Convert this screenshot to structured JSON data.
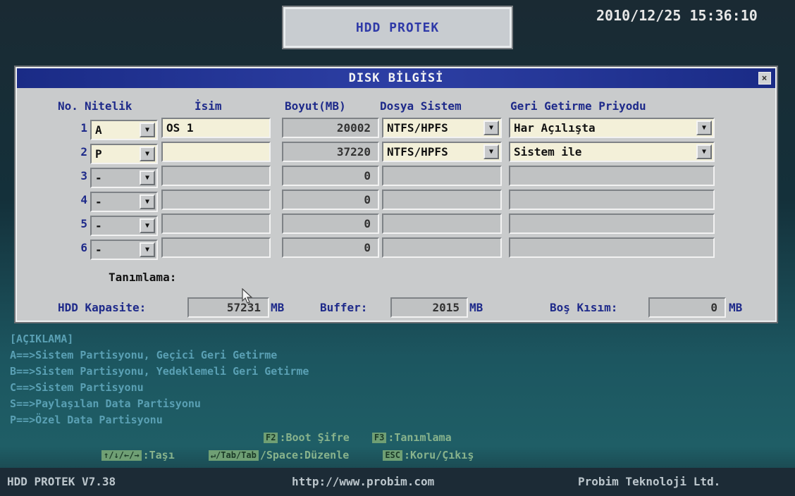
{
  "window": {
    "title": "HDD PROTEK",
    "clock": "2010/12/25 15:36:10"
  },
  "dialog": {
    "title": "DISK BİLGİSİ",
    "close_glyph": "×",
    "headers": {
      "no": "No.",
      "attribute": "Nitelik",
      "name": "İsim",
      "size": "Boyut(MB)",
      "filesystem": "Dosya Sistem",
      "restore": "Geri Getirme Priyodu"
    },
    "partitions": [
      {
        "no": "1",
        "attr": "A",
        "name": "OS 1",
        "size": "20002",
        "fs": "NTFS/HPFS",
        "restore": "Har Açılışta"
      },
      {
        "no": "2",
        "attr": "P",
        "name": "",
        "size": "37220",
        "fs": "NTFS/HPFS",
        "restore": "Sistem ile"
      },
      {
        "no": "3",
        "attr": "-",
        "name": "",
        "size": "0",
        "fs": "",
        "restore": ""
      },
      {
        "no": "4",
        "attr": "-",
        "name": "",
        "size": "0",
        "fs": "",
        "restore": ""
      },
      {
        "no": "5",
        "attr": "-",
        "name": "",
        "size": "0",
        "fs": "",
        "restore": ""
      },
      {
        "no": "6",
        "attr": "-",
        "name": "",
        "size": "0",
        "fs": "",
        "restore": ""
      }
    ],
    "description_label": "Tanımlama:",
    "capacity": {
      "label": "HDD Kapasite:",
      "value": "57231",
      "unit": "MB"
    },
    "buffer": {
      "label": "Buffer:",
      "value": "2015",
      "unit": "MB"
    },
    "free": {
      "label": "Boş Kısım:",
      "value": "0",
      "unit": "MB"
    }
  },
  "legend": {
    "title": "[AÇIKLAMA]",
    "items": [
      "A==>Sistem Partisyonu, Geçici Geri Getirme",
      "B==>Sistem Partisyonu, Yedeklemeli Geri Getirme",
      "C==>Sistem Partisyonu",
      "S==>Paylaşılan Data Partisyonu",
      "P==>Özel Data Partisyonu"
    ]
  },
  "hotkeys": {
    "f2_key": "F2",
    "f2_label": ":Boot Şifre",
    "f3_key": "F3",
    "f3_label": ":Tanımlama",
    "move_keys": "↑/↓/←/→",
    "move_label": ":Taşı",
    "edit_keys": "↵/Tab/Tab",
    "edit_label": "/Space:Düzenle",
    "esc_key": "ESC",
    "esc_label": ":Koru/Çıkış"
  },
  "statusbar": {
    "version": "HDD PROTEK V7.38",
    "url": "http://www.probim.com",
    "company": "Probim Teknoloji Ltd."
  }
}
